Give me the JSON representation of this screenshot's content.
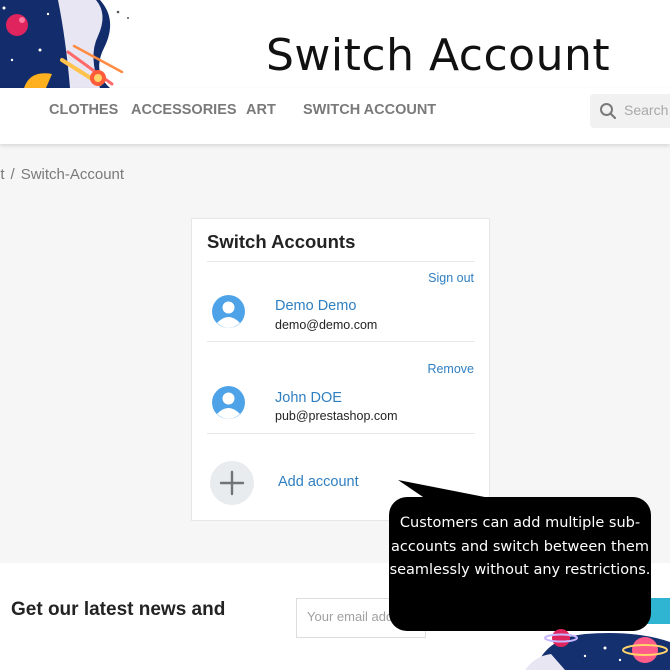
{
  "banner": {
    "title": "Switch Account"
  },
  "nav": {
    "items": [
      "CLOTHES",
      "ACCESSORIES",
      "ART",
      "SWITCH ACCOUNT"
    ],
    "search_placeholder": "Search"
  },
  "breadcrumb": {
    "parent": "nt",
    "separator": "/",
    "current": "Switch-Account"
  },
  "card": {
    "title": "Switch Accounts",
    "accounts": [
      {
        "action": "Sign out",
        "name": "Demo Demo",
        "email": "demo@demo.com"
      },
      {
        "action": "Remove",
        "name": "John DOE",
        "email": "pub@prestashop.com"
      }
    ],
    "add_label": "Add account"
  },
  "newsletter": {
    "title": "Get our latest news and",
    "email_placeholder": "Your email address"
  },
  "callout": {
    "text": "Customers can add multiple sub-accounts and switch between them seamlessly without any restrictions."
  },
  "colors": {
    "link": "#2f7fc1",
    "nav_text": "#7a7a7a",
    "callout_bg": "#000000",
    "subscribe": "#2fb5d2"
  },
  "icons": {
    "search": "search-icon",
    "avatar": "user-avatar-icon",
    "add": "plus-icon"
  }
}
